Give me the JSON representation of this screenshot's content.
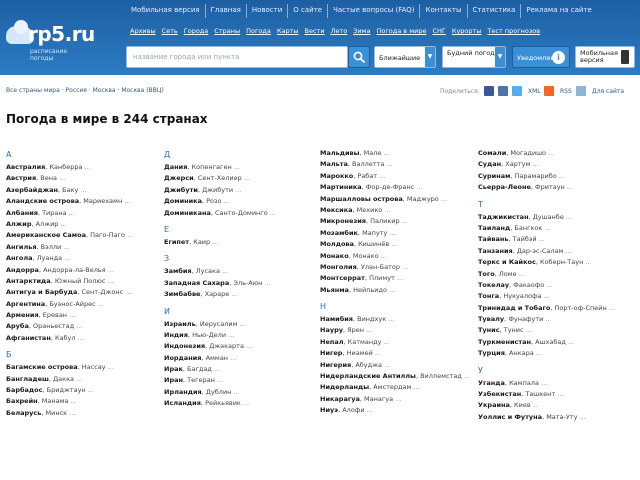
{
  "header": {
    "logo_text": "rp5.ru",
    "logo_sub": "расписание погоды",
    "top_nav": [
      "Мобильная версия",
      "Главная",
      "Новости",
      "О сайте",
      "Частые вопросы (FAQ)",
      "Контакты",
      "Статистика",
      "Реклама на сайте"
    ],
    "category_nav": [
      "Архивы",
      "Сеть",
      "Города",
      "Страны",
      "Погода",
      "Карты",
      "Вести",
      "Лето",
      "Зима",
      "Погода в мире",
      "СНГ",
      "Курорты",
      "Тест прогнозов"
    ],
    "search_placeholder": "название города или пункта",
    "select_search_mode": "Ближайшие",
    "select_period": "Будний погоды",
    "notify_label": "Уведомления",
    "mobile_label": "Мобильная версия"
  },
  "breadcrumb": "Все страны мира · Россия · Москва · Москва (ВВЦ)",
  "share_label": "Поделиться:",
  "tools": [
    "XML",
    "RSS",
    "Для сайта"
  ],
  "page_title": "Погода в мире в 244 странах",
  "columns": [
    {
      "groups": [
        {
          "letter": "А",
          "countries": [
            {
              "name": "Австралия",
              "capital": "Канберра"
            },
            {
              "name": "Австрия",
              "capital": "Вена"
            },
            {
              "name": "Азербайджан",
              "capital": "Баку"
            },
            {
              "name": "Аландские острова",
              "capital": "Мариехамн"
            },
            {
              "name": "Албания",
              "capital": "Тирана"
            },
            {
              "name": "Алжир",
              "capital": "Алжир"
            },
            {
              "name": "Американское Самоа",
              "capital": "Паго-Паго"
            },
            {
              "name": "Ангилья",
              "capital": "Вэлли"
            },
            {
              "name": "Ангола",
              "capital": "Луанда"
            },
            {
              "name": "Андорра",
              "capital": "Андорра-ла-Велья"
            },
            {
              "name": "Антарктида",
              "capital": "Южный Полюс"
            },
            {
              "name": "Антигуа и Барбуда",
              "capital": "Сент-Джонс"
            },
            {
              "name": "Аргентина",
              "capital": "Буэнос-Айрес"
            },
            {
              "name": "Армения",
              "capital": "Ереван"
            },
            {
              "name": "Аруба",
              "capital": "Ораньестад"
            },
            {
              "name": "Афганистан",
              "capital": "Кабул"
            }
          ]
        },
        {
          "letter": "Б",
          "countries": [
            {
              "name": "Багамские острова",
              "capital": "Нассау"
            },
            {
              "name": "Бангладеш",
              "capital": "Дакка"
            },
            {
              "name": "Барбадос",
              "capital": "Бриджтаун"
            },
            {
              "name": "Бахрейн",
              "capital": "Манама"
            },
            {
              "name": "Беларусь",
              "capital": "Минск"
            }
          ]
        }
      ]
    },
    {
      "groups": [
        {
          "letter": "Д",
          "countries": [
            {
              "name": "Дания",
              "capital": "Копенгаген"
            },
            {
              "name": "Джерси",
              "capital": "Сент-Хелиер"
            },
            {
              "name": "Джибути",
              "capital": "Джибути"
            },
            {
              "name": "Доминика",
              "capital": "Розо"
            },
            {
              "name": "Доминикана",
              "capital": "Санто-Доминго"
            }
          ]
        },
        {
          "letter": "Е",
          "countries": [
            {
              "name": "Египет",
              "capital": "Каир"
            }
          ]
        },
        {
          "letter": "З",
          "countries": [
            {
              "name": "Замбия",
              "capital": "Лусака"
            },
            {
              "name": "Западная Сахара",
              "capital": "Эль-Аюн"
            },
            {
              "name": "Зимбабве",
              "capital": "Хараре"
            }
          ]
        },
        {
          "letter": "И",
          "countries": [
            {
              "name": "Израиль",
              "capital": "Иерусалим"
            },
            {
              "name": "Индия",
              "capital": "Нью-Дели"
            },
            {
              "name": "Индонезия",
              "capital": "Джакарта"
            },
            {
              "name": "Иордания",
              "capital": "Амман"
            },
            {
              "name": "Ирак",
              "capital": "Багдад"
            },
            {
              "name": "Иран",
              "capital": "Тегеран"
            },
            {
              "name": "Ирландия",
              "capital": "Дублин"
            },
            {
              "name": "Исландия",
              "capital": "Рейкьявик"
            }
          ]
        }
      ]
    },
    {
      "groups": [
        {
          "letter": "",
          "countries": [
            {
              "name": "Мальдивы",
              "capital": "Мале"
            },
            {
              "name": "Мальта",
              "capital": "Валлетта"
            },
            {
              "name": "Марокко",
              "capital": "Рабат"
            },
            {
              "name": "Мартиника",
              "capital": "Фор-де-Франс"
            },
            {
              "name": "Маршалловы острова",
              "capital": "Маджуро"
            },
            {
              "name": "Мексика",
              "capital": "Мехико"
            },
            {
              "name": "Микронезия",
              "capital": "Паликир"
            },
            {
              "name": "Мозамбик",
              "capital": "Мапуту"
            },
            {
              "name": "Молдова",
              "capital": "Кишинёв"
            },
            {
              "name": "Монако",
              "capital": "Монако"
            },
            {
              "name": "Монголия",
              "capital": "Улан-Батор"
            },
            {
              "name": "Монтсеррат",
              "capital": "Плимут"
            },
            {
              "name": "Мьянма",
              "capital": "Нейпьидо"
            }
          ]
        },
        {
          "letter": "Н",
          "countries": [
            {
              "name": "Намибия",
              "capital": "Виндхук"
            },
            {
              "name": "Науру",
              "capital": "Ярен"
            },
            {
              "name": "Непал",
              "capital": "Катманду"
            },
            {
              "name": "Нигер",
              "capital": "Ниамей"
            },
            {
              "name": "Нигерия",
              "capital": "Абуджа"
            },
            {
              "name": "Нидерландские Антиллы",
              "capital": "Виллемстад"
            },
            {
              "name": "Нидерланды",
              "capital": "Амстердам"
            },
            {
              "name": "Никарагуа",
              "capital": "Манагуа"
            },
            {
              "name": "Ниуэ",
              "capital": "Алофи"
            }
          ]
        }
      ]
    },
    {
      "groups": [
        {
          "letter": "",
          "countries": [
            {
              "name": "Сомали",
              "capital": "Могадишо"
            },
            {
              "name": "Судан",
              "capital": "Хартум"
            },
            {
              "name": "Суринам",
              "capital": "Парамарибо"
            },
            {
              "name": "Сьерра-Леоне",
              "capital": "Фритаун"
            }
          ]
        },
        {
          "letter": "Т",
          "countries": [
            {
              "name": "Таджикистан",
              "capital": "Душанбе"
            },
            {
              "name": "Таиланд",
              "capital": "Бангкок"
            },
            {
              "name": "Тайвань",
              "capital": "Тайбэй"
            },
            {
              "name": "Танзания",
              "capital": "Дар-эс-Салам"
            },
            {
              "name": "Теркс и Кайкос",
              "capital": "Коберн-Таун"
            },
            {
              "name": "Того",
              "capital": "Ломе"
            },
            {
              "name": "Токелау",
              "capital": "Факаофо"
            },
            {
              "name": "Тонга",
              "capital": "Нукуалофа"
            },
            {
              "name": "Тринидад и Тобаго",
              "capital": "Порт-оф-Спейн"
            },
            {
              "name": "Тувалу",
              "capital": "Фунафути"
            },
            {
              "name": "Тунис",
              "capital": "Тунис"
            },
            {
              "name": "Туркменистан",
              "capital": "Ашхабад"
            },
            {
              "name": "Турция",
              "capital": "Анкара"
            }
          ]
        },
        {
          "letter": "У",
          "countries": [
            {
              "name": "Уганда",
              "capital": "Кампала"
            },
            {
              "name": "Узбекистан",
              "capital": "Ташкент"
            },
            {
              "name": "Украина",
              "capital": "Киев"
            },
            {
              "name": "Уоллис и Футуна",
              "capital": "Мата-Уту"
            }
          ]
        }
      ]
    }
  ]
}
